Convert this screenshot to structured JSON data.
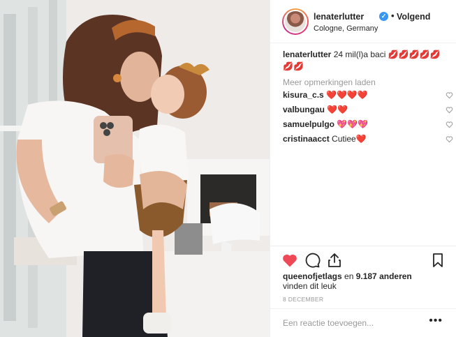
{
  "header": {
    "username": "lenaterlutter",
    "verified_mark": "✓",
    "separator": "•",
    "follow_label": "Volgend",
    "location": "Cologne, Germany"
  },
  "caption": {
    "username": "lenaterlutter",
    "text": " 24 mil(l)a baci 💋💋💋💋💋💋💋"
  },
  "load_more": "Meer opmerkingen laden",
  "comments": [
    {
      "user": "kisura_c.s",
      "text": " ❤️❤️❤️❤️"
    },
    {
      "user": "valbungau",
      "text": " ❤️❤️"
    },
    {
      "user": "samuelpulgo",
      "text": " 💖💖💖"
    },
    {
      "user": "cristinaacct",
      "text": " Cutiee❤️"
    }
  ],
  "likes": {
    "user": "queenofjetlags",
    "middle": " en ",
    "count": "9.187 anderen",
    "suffix": "vinden dit leuk"
  },
  "date": "8 DECEMBER",
  "comment_placeholder": "Een reactie toevoegen...",
  "more_options": "•••",
  "colors": {
    "like_red": "#ed4956",
    "verified_blue": "#3897f0",
    "muted_gray": "#999999"
  },
  "icons": [
    "heart-filled-icon",
    "comment-icon",
    "share-icon",
    "bookmark-icon",
    "verified-icon",
    "heart-outline-icon"
  ]
}
